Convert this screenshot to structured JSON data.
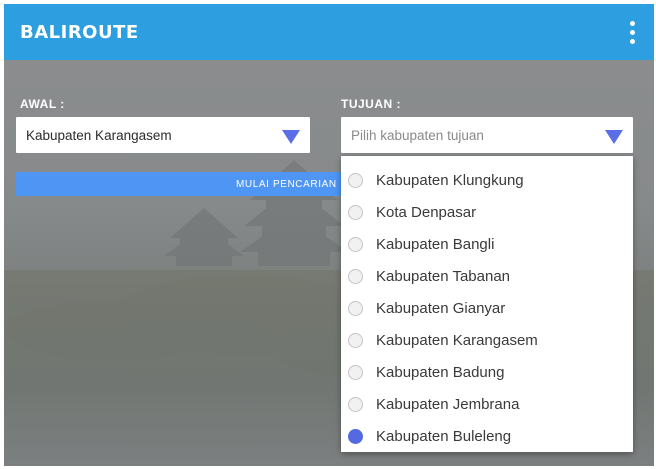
{
  "app": {
    "title": "BALIROUTE"
  },
  "form": {
    "awal": {
      "label": "AWAL :",
      "value": "Kabupaten Karangasem"
    },
    "tujuan": {
      "label": "TUJUAN :",
      "placeholder": "Pilih kabupaten tujuan"
    },
    "search_button": "MULAI PENCARIAN"
  },
  "dropdown": {
    "options": [
      {
        "label": "Kabupaten Klungkung",
        "selected": false
      },
      {
        "label": "Kota Denpasar",
        "selected": false
      },
      {
        "label": "Kabupaten Bangli",
        "selected": false
      },
      {
        "label": "Kabupaten Tabanan",
        "selected": false
      },
      {
        "label": "Kabupaten Gianyar",
        "selected": false
      },
      {
        "label": "Kabupaten Karangasem",
        "selected": false
      },
      {
        "label": "Kabupaten Badung",
        "selected": false
      },
      {
        "label": "Kabupaten Jembrana",
        "selected": false
      },
      {
        "label": "Kabupaten Buleleng",
        "selected": true
      }
    ]
  },
  "colors": {
    "appbar": "#2d9ee0",
    "accent": "#5569e0",
    "button": "#4e95f4"
  },
  "icons": {
    "menu": "more-vert-icon",
    "select": "triangle-down-icon",
    "option": "radio-icon"
  }
}
